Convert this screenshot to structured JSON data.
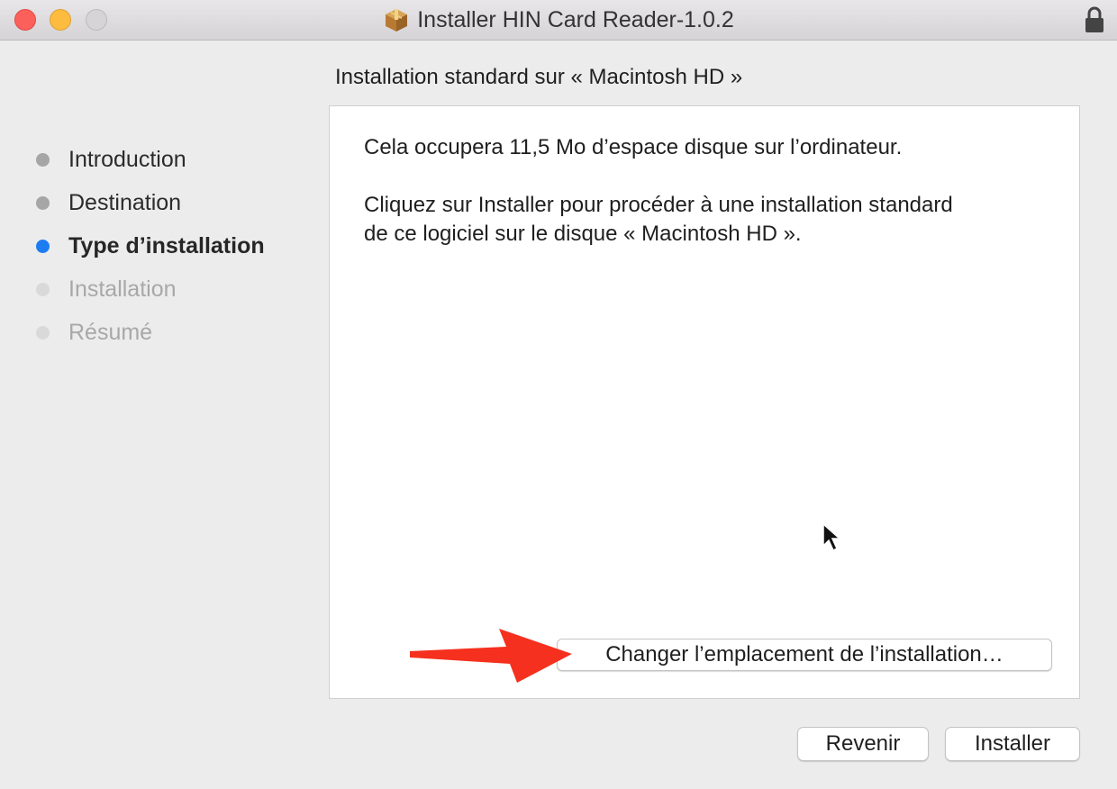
{
  "window": {
    "title": "Installer HIN Card Reader-1.0.2"
  },
  "sidebar": {
    "steps": [
      {
        "label": "Introduction",
        "state": "done"
      },
      {
        "label": "Destination",
        "state": "done"
      },
      {
        "label": "Type d’installation",
        "state": "current"
      },
      {
        "label": "Installation",
        "state": "todo"
      },
      {
        "label": "Résumé",
        "state": "todo"
      }
    ]
  },
  "main": {
    "header": "Installation standard sur « Macintosh HD »",
    "paragraph1": "Cela occupera 11,5 Mo d’espace disque sur l’ordinateur.",
    "paragraph2_line1": "Cliquez sur Installer pour procéder à une installation standard",
    "paragraph2_line2": "de ce logiciel sur le disque « Macintosh HD ».",
    "change_location_label": "Changer l’emplacement de l’installation…"
  },
  "footer": {
    "back_label": "Revenir",
    "install_label": "Installer"
  },
  "colors": {
    "accent_current_step": "#1e7cf2",
    "annotation_arrow": "#f5301e",
    "window_background": "#ececec"
  },
  "icons": {
    "title": "package-icon",
    "lock": "lock-icon",
    "annotation": "red-arrow-icon",
    "pointer": "mouse-cursor-icon"
  }
}
